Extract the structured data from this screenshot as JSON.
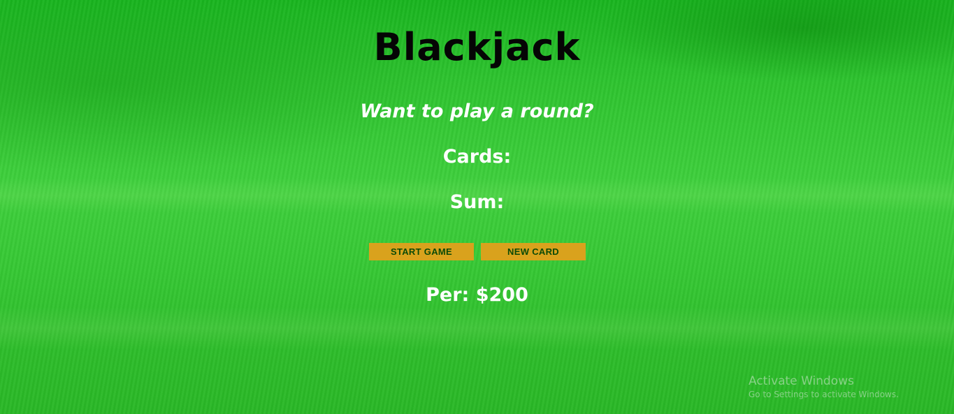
{
  "game": {
    "title": "Blackjack",
    "message": "Want to play a round?",
    "cards_label": "Cards:",
    "sum_label": "Sum:",
    "player_line": "Per: $200"
  },
  "buttons": {
    "start_label": "START GAME",
    "new_card_label": "NEW CARD"
  },
  "watermark": {
    "title": "Activate Windows",
    "subtitle": "Go to Settings to activate Windows."
  },
  "colors": {
    "background": "#2ec42f",
    "title": "#050505",
    "text": "#ffffff",
    "button_bg": "#d9a21d",
    "button_text": "#0b4a07"
  }
}
